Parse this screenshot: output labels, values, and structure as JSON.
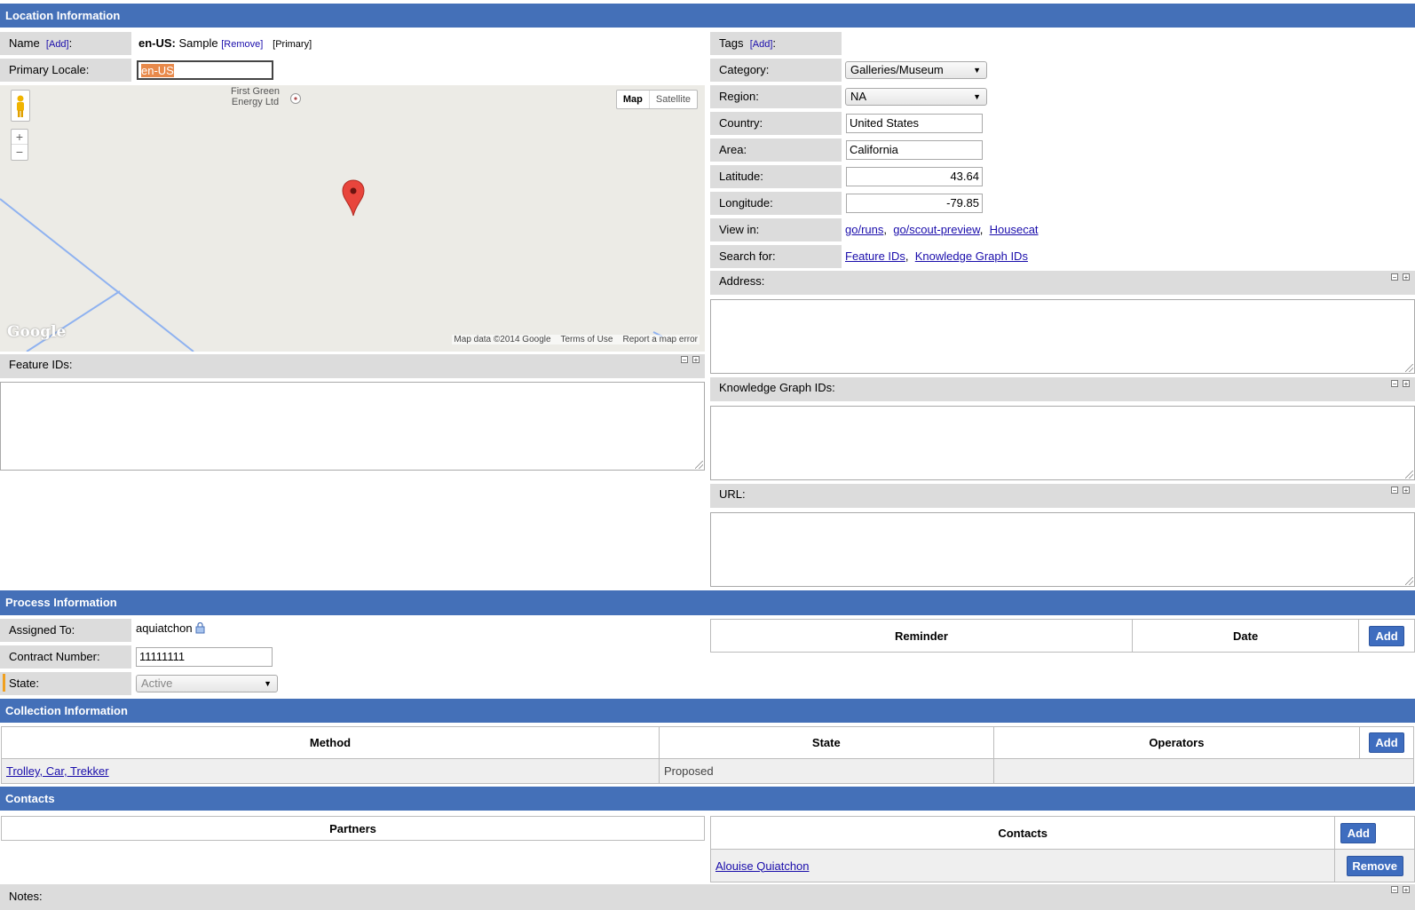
{
  "location": {
    "title": "Location Information",
    "name_label": "Name",
    "add_link": "[Add]",
    "locale_code": "en-US:",
    "locale_value": "Sample",
    "remove_link": "[Remove]",
    "primary_tag": "[Primary]",
    "primary_locale_label": "Primary Locale:",
    "primary_locale_value": "en-US",
    "tags_label": "Tags",
    "tags_add": "[Add]",
    "tags_colon": ":",
    "category_label": "Category:",
    "category_value": "Galleries/Museum",
    "region_label": "Region:",
    "region_value": "NA",
    "country_label": "Country:",
    "country_value": "United States",
    "area_label": "Area:",
    "area_value": "California",
    "latitude_label": "Latitude:",
    "latitude_value": "43.64",
    "longitude_label": "Longitude:",
    "longitude_value": "-79.85",
    "view_in_label": "View in:",
    "view_in_links": [
      "go/runs",
      "go/scout-preview",
      "Housecat"
    ],
    "search_for_label": "Search for:",
    "search_for_links": [
      "Feature IDs",
      "Knowledge Graph IDs"
    ],
    "address_label": "Address:",
    "feature_ids_label": "Feature IDs:",
    "kg_ids_label": "Knowledge Graph IDs:",
    "url_label": "URL:"
  },
  "map": {
    "poi_label_1": "First Green",
    "poi_label_2": "Energy Ltd",
    "map_button": "Map",
    "satellite_button": "Satellite",
    "zoom_in": "+",
    "zoom_out": "−",
    "logo": "Google",
    "attribution": "Map data ©2014 Google",
    "terms": "Terms of Use",
    "report": "Report a map error"
  },
  "process": {
    "title": "Process Information",
    "assigned_label": "Assigned To:",
    "assigned_value": "aquiatchon",
    "contract_label": "Contract Number:",
    "contract_value": "11111111",
    "state_label": "State:",
    "state_value": "Active",
    "reminder_header": "Reminder",
    "date_header": "Date",
    "add_button": "Add"
  },
  "collection": {
    "title": "Collection Information",
    "headers": {
      "method": "Method",
      "state": "State",
      "operators": "Operators"
    },
    "add_button": "Add",
    "rows": [
      {
        "method": "Trolley, Car, Trekker",
        "state": "Proposed",
        "operators": ""
      }
    ]
  },
  "contacts": {
    "title": "Contacts",
    "partners_header": "Partners",
    "contacts_header": "Contacts",
    "add_button": "Add",
    "rows": [
      {
        "name": "Alouise Quiatchon",
        "remove_button": "Remove"
      }
    ]
  },
  "notes": {
    "label": "Notes:"
  },
  "colors": {
    "header_bar": "#4470b8",
    "label_bg": "#dcdcdc",
    "button": "#3e6dbf",
    "required_marker": "#e07070",
    "state_marker": "#f0a020"
  }
}
